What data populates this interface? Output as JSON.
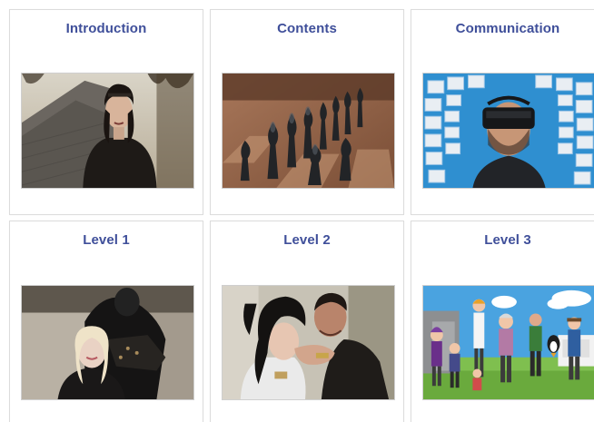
{
  "cards": [
    {
      "title": "Introduction",
      "image": "avatar-woman-rooftop-image"
    },
    {
      "title": "Contents",
      "image": "chess-pieces-image"
    },
    {
      "title": "Communication",
      "image": "vr-headset-faces-image"
    },
    {
      "title": "Level 1",
      "image": "avatar-couple-embrace-image"
    },
    {
      "title": "Level 2",
      "image": "avatar-couple-closeup-image"
    },
    {
      "title": "Level 3",
      "image": "cartoon-people-group-image"
    }
  ],
  "colors": {
    "title": "#3f4f9a",
    "card_border": "#dcdcdc",
    "background": "#ffffff"
  }
}
